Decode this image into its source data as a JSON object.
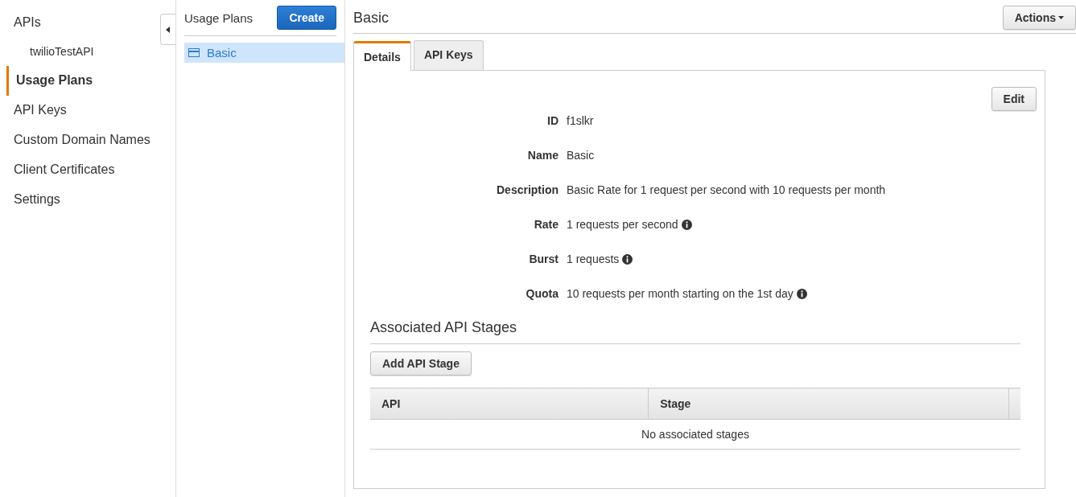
{
  "nav": {
    "items": [
      {
        "label": "APIs",
        "kind": "top",
        "selected": false
      },
      {
        "label": "twilioTestAPI",
        "kind": "sub",
        "selected": false
      },
      {
        "label": "Usage Plans",
        "kind": "top",
        "selected": true
      },
      {
        "label": "API Keys",
        "kind": "top",
        "selected": false
      },
      {
        "label": "Custom Domain Names",
        "kind": "top",
        "selected": false
      },
      {
        "label": "Client Certificates",
        "kind": "top",
        "selected": false
      },
      {
        "label": "Settings",
        "kind": "top",
        "selected": false
      }
    ]
  },
  "plans": {
    "title": "Usage Plans",
    "create_button": "Create",
    "items": [
      {
        "label": "Basic",
        "selected": true
      }
    ]
  },
  "main": {
    "title": "Basic",
    "actions_button": "Actions",
    "tabs": [
      {
        "label": "Details",
        "selected": true
      },
      {
        "label": "API Keys",
        "selected": false
      }
    ],
    "edit_button": "Edit",
    "fields": [
      {
        "label": "ID",
        "value": "f1slkr",
        "info": false
      },
      {
        "label": "Name",
        "value": "Basic",
        "info": false
      },
      {
        "label": "Description",
        "value": "Basic Rate for 1 request per second with 10 requests per month",
        "info": false
      },
      {
        "label": "Rate",
        "value": "1 requests per second",
        "info": true
      },
      {
        "label": "Burst",
        "value": "1 requests",
        "info": true
      },
      {
        "label": "Quota",
        "value": "10 requests per month starting on the 1st day",
        "info": true
      }
    ],
    "stages": {
      "title": "Associated API Stages",
      "add_button": "Add API Stage",
      "columns": [
        "API",
        "Stage"
      ],
      "empty_message": "No associated stages"
    }
  }
}
